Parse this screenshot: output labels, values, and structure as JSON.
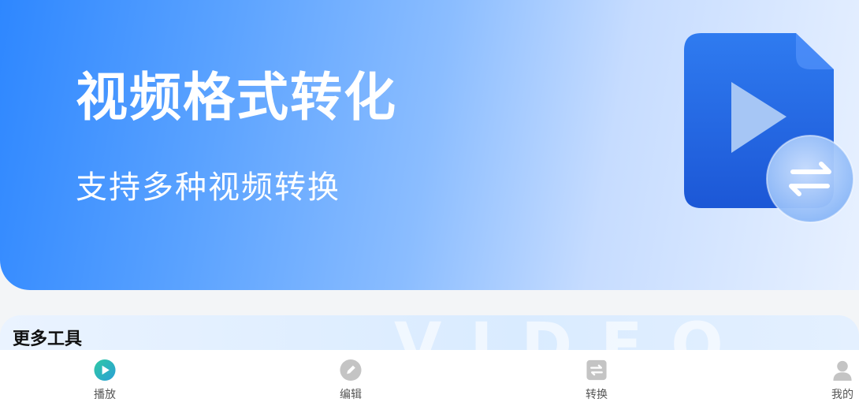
{
  "banner": {
    "title": "视频格式转化",
    "subtitle": "支持多种视频转换",
    "illustration_icon": "video-convert-icon"
  },
  "tools": {
    "title": "更多工具",
    "watermark": "VIDEO"
  },
  "tabbar": {
    "items": [
      {
        "label": "播放",
        "icon": "play-icon"
      },
      {
        "label": "编辑",
        "icon": "edit-icon"
      },
      {
        "label": "转换",
        "icon": "convert-icon"
      },
      {
        "label": "我的",
        "icon": "user-icon"
      }
    ]
  },
  "colors": {
    "banner_start": "#2e87ff",
    "banner_end": "#e8f1ff",
    "play_accent": "#2fbfae",
    "tab_icon_gray": "#c4c4c4"
  }
}
